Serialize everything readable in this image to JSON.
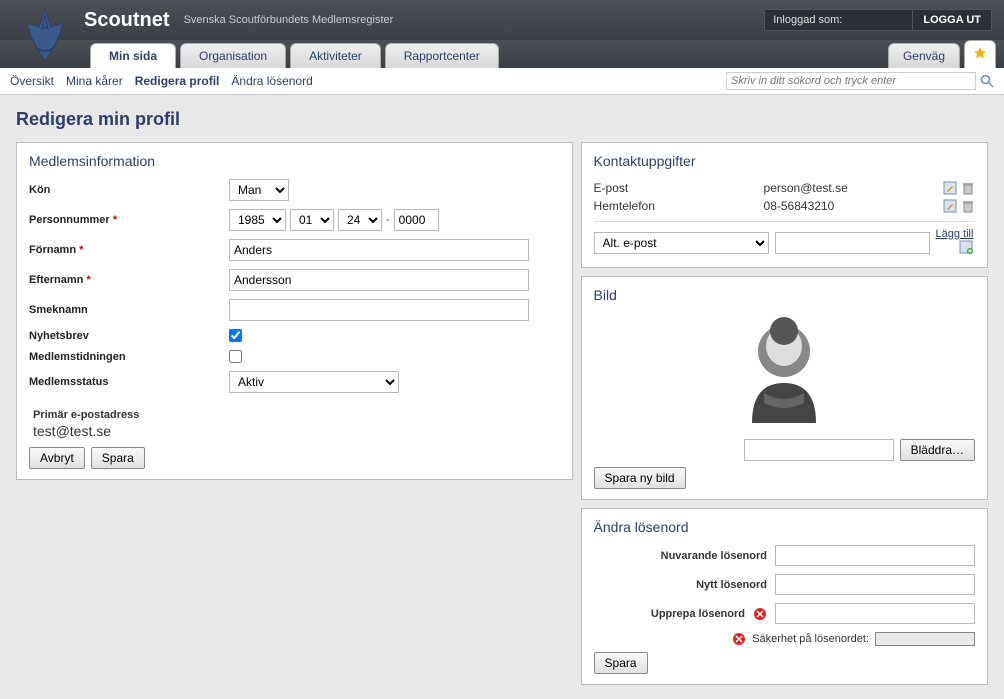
{
  "header": {
    "app_title": "Scoutnet",
    "app_sub": "Svenska Scoutförbundets Medlemsregister",
    "logged_in_label": "Inloggad som:",
    "logout_label": "LOGGA UT"
  },
  "tabs": [
    {
      "label": "Min sida",
      "active": true
    },
    {
      "label": "Organisation",
      "active": false
    },
    {
      "label": "Aktiviteter",
      "active": false
    },
    {
      "label": "Rapportcenter",
      "active": false
    }
  ],
  "shortcut_label": "Genväg",
  "subnav": [
    {
      "label": "Översikt",
      "active": false
    },
    {
      "label": "Mina kårer",
      "active": false
    },
    {
      "label": "Redigera profil",
      "active": true
    },
    {
      "label": "Ändra lösenord",
      "active": false
    }
  ],
  "search": {
    "placeholder": "Skriv in ditt sökord och tryck enter"
  },
  "page_title": "Redigera min profil",
  "member_panel": {
    "title": "Medlemsinformation",
    "labels": {
      "kon": "Kön",
      "personnummer": "Personnummer",
      "fornamn": "Förnamn",
      "efternamn": "Efternamn",
      "smeknamn": "Smeknamn",
      "nyhetsbrev": "Nyhetsbrev",
      "medlemstidningen": "Medlemstidningen",
      "medlemsstatus": "Medlemsstatus",
      "primar_epost": "Primär e-postadress"
    },
    "values": {
      "kon": "Man",
      "pn_year": "1985",
      "pn_month": "01",
      "pn_day": "24",
      "pn_suffix": "0000",
      "fornamn": "Anders",
      "efternamn": "Andersson",
      "smeknamn": "",
      "nyhetsbrev_checked": true,
      "medlemstidningen_checked": false,
      "medlemsstatus": "Aktiv",
      "primar_epost": "test@test.se"
    },
    "buttons": {
      "avbryt": "Avbryt",
      "spara": "Spara"
    }
  },
  "contact_panel": {
    "title": "Kontaktuppgifter",
    "rows": [
      {
        "label": "E-post",
        "value": "person@test.se"
      },
      {
        "label": "Hemtelefon",
        "value": "08-56843210"
      }
    ],
    "add_select": "Alt. e-post",
    "add_link": "Lägg till"
  },
  "bild_panel": {
    "title": "Bild",
    "browse": "Bläddra…",
    "save": "Spara ny bild"
  },
  "pw_panel": {
    "title": "Ändra lösenord",
    "labels": {
      "current": "Nuvarande lösenord",
      "new": "Nytt lösenord",
      "repeat": "Upprepa lösenord",
      "strength": "Säkerhet på lösenordet:"
    },
    "save": "Spara"
  }
}
